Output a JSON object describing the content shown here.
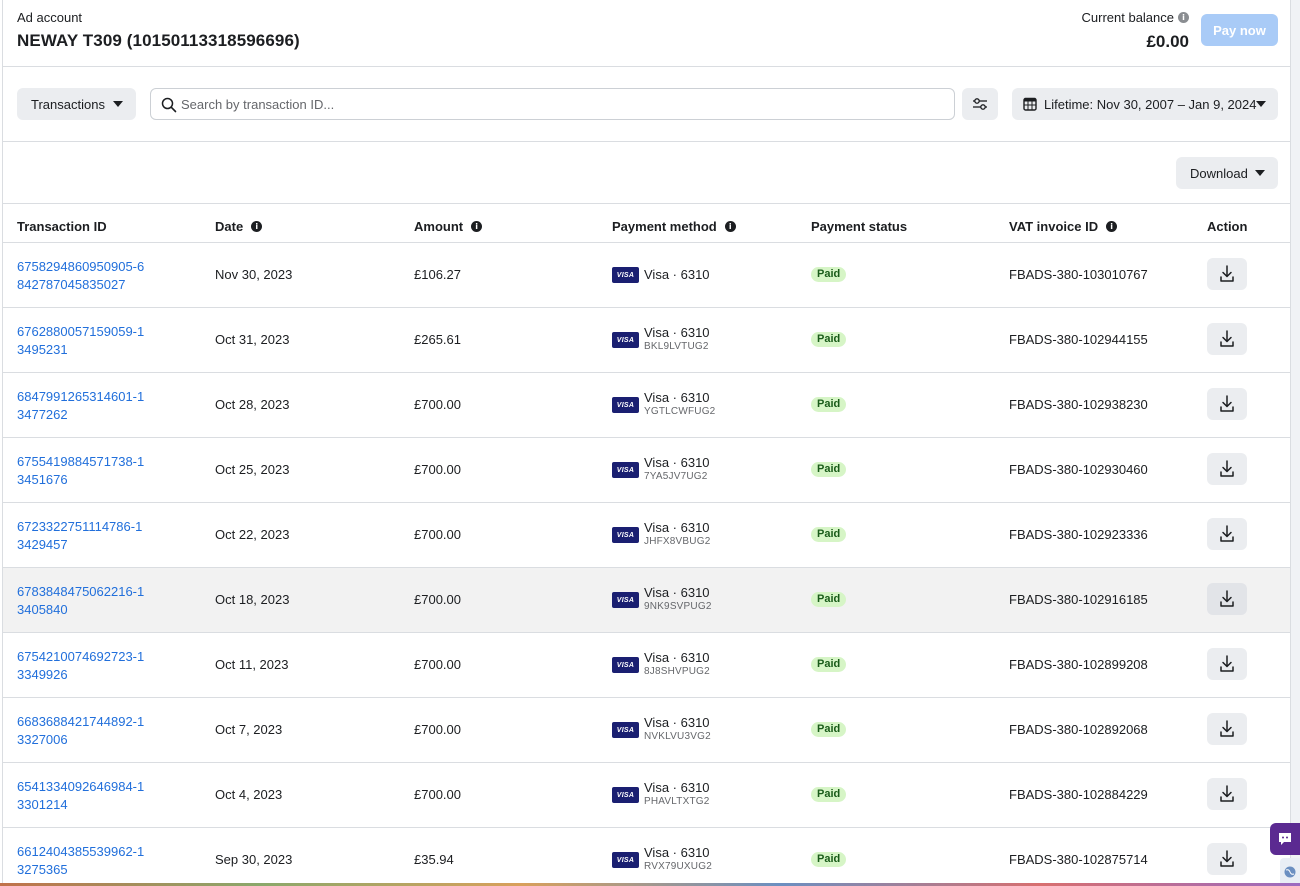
{
  "header": {
    "account_label": "Ad account",
    "account_name": "NEWAY T309 (10150113318596696)",
    "balance_label": "Current balance",
    "balance_value": "£0.00",
    "pay_now": "Pay now"
  },
  "toolbar": {
    "view_select": "Transactions",
    "search_placeholder": "Search by transaction ID...",
    "date_range": "Lifetime: Nov 30, 2007 – Jan 9, 2024",
    "download_label": "Download"
  },
  "table": {
    "columns": {
      "transaction_id": "Transaction ID",
      "date": "Date",
      "amount": "Amount",
      "payment_method": "Payment method",
      "payment_status": "Payment status",
      "vat_invoice_id": "VAT invoice ID",
      "action": "Action"
    },
    "rows": [
      {
        "id": "6758294860950905-6842787045835027",
        "date": "Nov 30, 2023",
        "amount": "£106.27",
        "method": "Visa · 6310",
        "method_ref": "",
        "status": "Paid",
        "vat": "FBADS-380-103010767"
      },
      {
        "id": "6762880057159059-13495231",
        "date": "Oct 31, 2023",
        "amount": "£265.61",
        "method": "Visa · 6310",
        "method_ref": "BKL9LVTUG2",
        "status": "Paid",
        "vat": "FBADS-380-102944155"
      },
      {
        "id": "6847991265314601-13477262",
        "date": "Oct 28, 2023",
        "amount": "£700.00",
        "method": "Visa · 6310",
        "method_ref": "YGTLCWFUG2",
        "status": "Paid",
        "vat": "FBADS-380-102938230"
      },
      {
        "id": "6755419884571738-13451676",
        "date": "Oct 25, 2023",
        "amount": "£700.00",
        "method": "Visa · 6310",
        "method_ref": "7YA5JV7UG2",
        "status": "Paid",
        "vat": "FBADS-380-102930460"
      },
      {
        "id": "6723322751114786-13429457",
        "date": "Oct 22, 2023",
        "amount": "£700.00",
        "method": "Visa · 6310",
        "method_ref": "JHFX8VBUG2",
        "status": "Paid",
        "vat": "FBADS-380-102923336"
      },
      {
        "id": "6783848475062216-13405840",
        "date": "Oct 18, 2023",
        "amount": "£700.00",
        "method": "Visa · 6310",
        "method_ref": "9NK9SVPUG2",
        "status": "Paid",
        "vat": "FBADS-380-102916185"
      },
      {
        "id": "6754210074692723-13349926",
        "date": "Oct 11, 2023",
        "amount": "£700.00",
        "method": "Visa · 6310",
        "method_ref": "8J8SHVPUG2",
        "status": "Paid",
        "vat": "FBADS-380-102899208"
      },
      {
        "id": "6683688421744892-13327006",
        "date": "Oct 7, 2023",
        "amount": "£700.00",
        "method": "Visa · 6310",
        "method_ref": "NVKLVU3VG2",
        "status": "Paid",
        "vat": "FBADS-380-102892068"
      },
      {
        "id": "6541334092646984-13301214",
        "date": "Oct 4, 2023",
        "amount": "£700.00",
        "method": "Visa · 6310",
        "method_ref": "PHAVLTXTG2",
        "status": "Paid",
        "vat": "FBADS-380-102884229"
      },
      {
        "id": "6612404385539962-13275365",
        "date": "Sep 30, 2023",
        "amount": "£35.94",
        "method": "Visa · 6310",
        "method_ref": "RVX79UXUG2",
        "status": "Paid",
        "vat": "FBADS-380-102875714"
      }
    ],
    "highlighted_row": 5
  },
  "card_brand": "VISA",
  "colors": {
    "link": "#216fdb",
    "pay_button_disabled": "#a9cbf7",
    "paid_badge_bg": "#d6f5c6",
    "chat_button": "#5b2a91"
  }
}
